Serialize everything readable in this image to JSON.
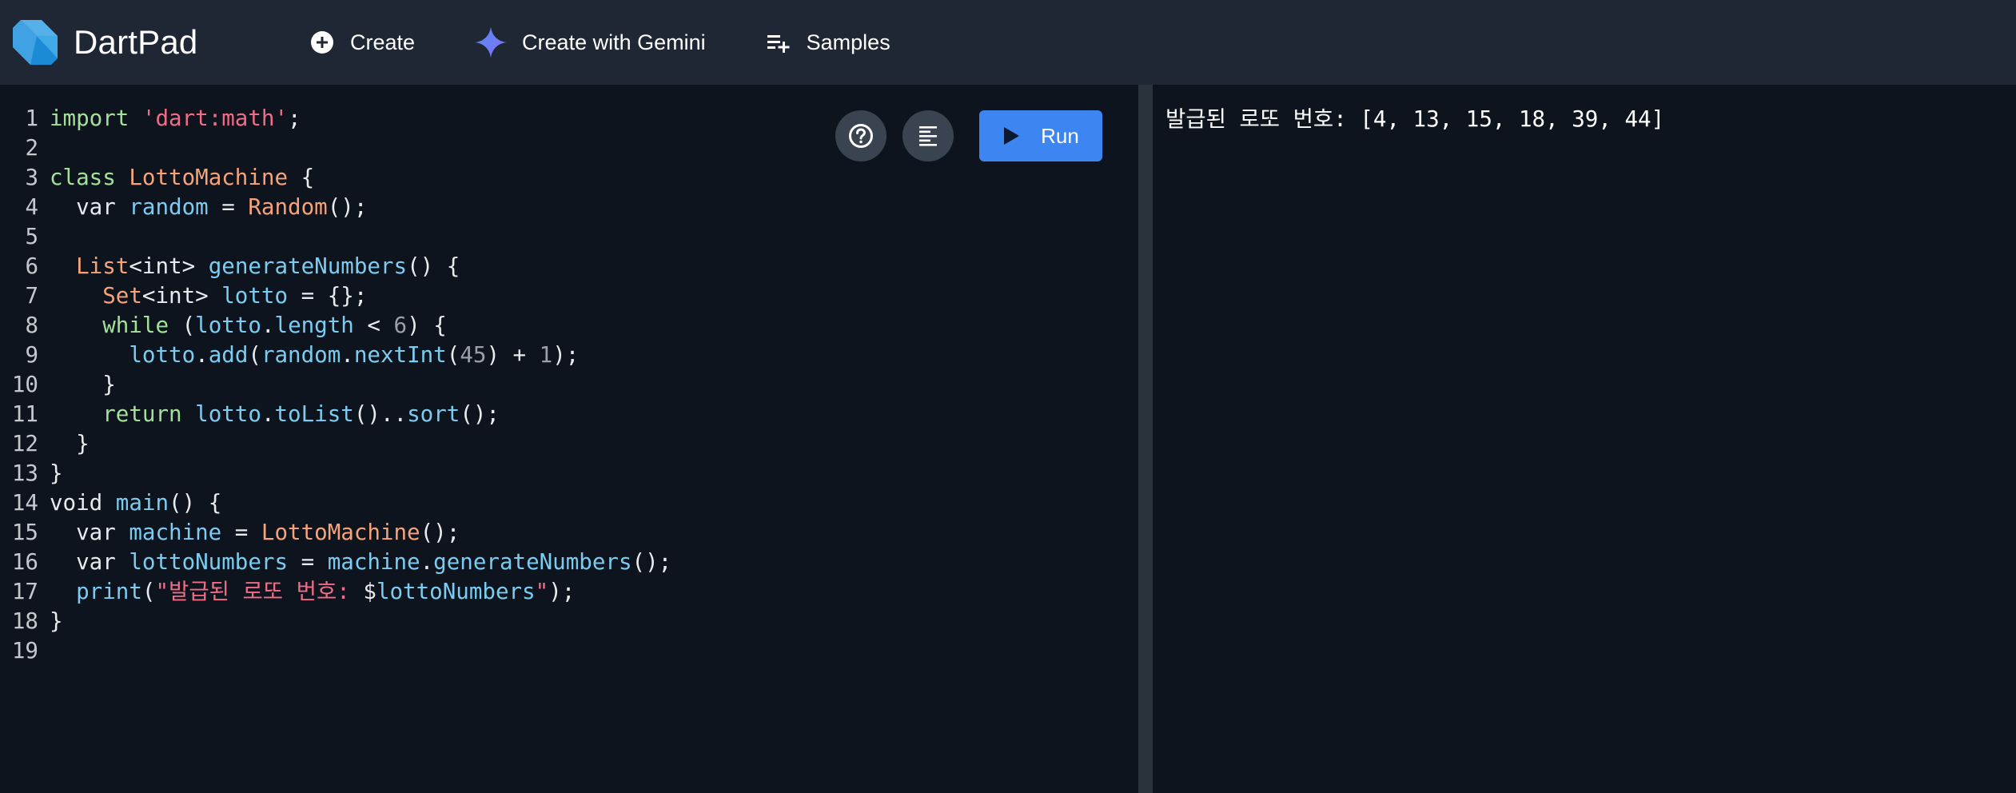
{
  "app": {
    "title": "DartPad"
  },
  "nav": {
    "create_label": "Create",
    "gemini_label": "Create with Gemini",
    "samples_label": "Samples"
  },
  "editor": {
    "run_label": "Run",
    "lines": [
      {
        "n": "1",
        "tokens": [
          {
            "c": "k",
            "v": "import"
          },
          {
            "c": "",
            "v": " "
          },
          {
            "c": "s",
            "v": "'dart:math'"
          },
          {
            "c": "",
            "v": ";"
          }
        ]
      },
      {
        "n": "2",
        "tokens": []
      },
      {
        "n": "3",
        "tokens": [
          {
            "c": "k",
            "v": "class"
          },
          {
            "c": "",
            "v": " "
          },
          {
            "c": "t",
            "v": "LottoMachine"
          },
          {
            "c": "",
            "v": " {"
          }
        ]
      },
      {
        "n": "4",
        "tokens": [
          {
            "c": "",
            "v": "  var "
          },
          {
            "c": "i",
            "v": "random"
          },
          {
            "c": "",
            "v": " = "
          },
          {
            "c": "t",
            "v": "Random"
          },
          {
            "c": "",
            "v": "();"
          }
        ]
      },
      {
        "n": "5",
        "tokens": []
      },
      {
        "n": "6",
        "tokens": [
          {
            "c": "",
            "v": "  "
          },
          {
            "c": "t",
            "v": "List"
          },
          {
            "c": "",
            "v": "<int> "
          },
          {
            "c": "i",
            "v": "generateNumbers"
          },
          {
            "c": "",
            "v": "() {"
          }
        ]
      },
      {
        "n": "7",
        "tokens": [
          {
            "c": "",
            "v": "    "
          },
          {
            "c": "t",
            "v": "Set"
          },
          {
            "c": "",
            "v": "<int> "
          },
          {
            "c": "i",
            "v": "lotto"
          },
          {
            "c": "",
            "v": " = {};"
          }
        ]
      },
      {
        "n": "8",
        "tokens": [
          {
            "c": "",
            "v": "    "
          },
          {
            "c": "k",
            "v": "while"
          },
          {
            "c": "",
            "v": " ("
          },
          {
            "c": "i",
            "v": "lotto"
          },
          {
            "c": "",
            "v": "."
          },
          {
            "c": "i",
            "v": "length"
          },
          {
            "c": "",
            "v": " < "
          },
          {
            "c": "n",
            "v": "6"
          },
          {
            "c": "",
            "v": ") {"
          }
        ]
      },
      {
        "n": "9",
        "tokens": [
          {
            "c": "",
            "v": "      "
          },
          {
            "c": "i",
            "v": "lotto"
          },
          {
            "c": "",
            "v": "."
          },
          {
            "c": "i",
            "v": "add"
          },
          {
            "c": "",
            "v": "("
          },
          {
            "c": "i",
            "v": "random"
          },
          {
            "c": "",
            "v": "."
          },
          {
            "c": "i",
            "v": "nextInt"
          },
          {
            "c": "",
            "v": "("
          },
          {
            "c": "n",
            "v": "45"
          },
          {
            "c": "",
            "v": ") + "
          },
          {
            "c": "n",
            "v": "1"
          },
          {
            "c": "",
            "v": ");"
          }
        ]
      },
      {
        "n": "10",
        "tokens": [
          {
            "c": "",
            "v": "    }"
          }
        ]
      },
      {
        "n": "11",
        "tokens": [
          {
            "c": "",
            "v": "    "
          },
          {
            "c": "k",
            "v": "return"
          },
          {
            "c": "",
            "v": " "
          },
          {
            "c": "i",
            "v": "lotto"
          },
          {
            "c": "",
            "v": "."
          },
          {
            "c": "i",
            "v": "toList"
          },
          {
            "c": "",
            "v": "().."
          },
          {
            "c": "i",
            "v": "sort"
          },
          {
            "c": "",
            "v": "();"
          }
        ]
      },
      {
        "n": "12",
        "tokens": [
          {
            "c": "",
            "v": "  }"
          }
        ]
      },
      {
        "n": "13",
        "tokens": [
          {
            "c": "",
            "v": "}"
          }
        ]
      },
      {
        "n": "14",
        "tokens": [
          {
            "c": "",
            "v": "void "
          },
          {
            "c": "i",
            "v": "main"
          },
          {
            "c": "",
            "v": "() {"
          }
        ]
      },
      {
        "n": "15",
        "tokens": [
          {
            "c": "",
            "v": "  var "
          },
          {
            "c": "i",
            "v": "machine"
          },
          {
            "c": "",
            "v": " = "
          },
          {
            "c": "t",
            "v": "LottoMachine"
          },
          {
            "c": "",
            "v": "();"
          }
        ]
      },
      {
        "n": "16",
        "tokens": [
          {
            "c": "",
            "v": "  var "
          },
          {
            "c": "i",
            "v": "lottoNumbers"
          },
          {
            "c": "",
            "v": " = "
          },
          {
            "c": "i",
            "v": "machine"
          },
          {
            "c": "",
            "v": "."
          },
          {
            "c": "i",
            "v": "generateNumbers"
          },
          {
            "c": "",
            "v": "();"
          }
        ]
      },
      {
        "n": "17",
        "tokens": [
          {
            "c": "",
            "v": "  "
          },
          {
            "c": "i",
            "v": "print"
          },
          {
            "c": "",
            "v": "("
          },
          {
            "c": "s",
            "v": "\"발급된 로또 번호: "
          },
          {
            "c": "",
            "v": "$"
          },
          {
            "c": "i",
            "v": "lottoNumbers"
          },
          {
            "c": "s",
            "v": "\""
          },
          {
            "c": "",
            "v": ");"
          }
        ]
      },
      {
        "n": "18",
        "tokens": [
          {
            "c": "",
            "v": "}"
          }
        ]
      },
      {
        "n": "19",
        "tokens": []
      }
    ]
  },
  "console": {
    "output": "발급된 로또 번호: [4, 13, 15, 18, 39, 44]"
  },
  "colors": {
    "appbar": "#1e2733",
    "background": "#0d141d",
    "run_button": "#3d86f2",
    "keyword": "#a3e19a",
    "string": "#ef6d86",
    "type": "#f6a37a",
    "identifier": "#7ccbf0",
    "number": "#9aa0a6"
  },
  "icons": {
    "logo": "dart-logo-icon",
    "create": "add-circle-icon",
    "gemini": "gemini-sparkle-icon",
    "samples": "playlist-add-icon",
    "help": "help-circle-icon",
    "format": "format-align-icon",
    "run": "play-icon"
  }
}
